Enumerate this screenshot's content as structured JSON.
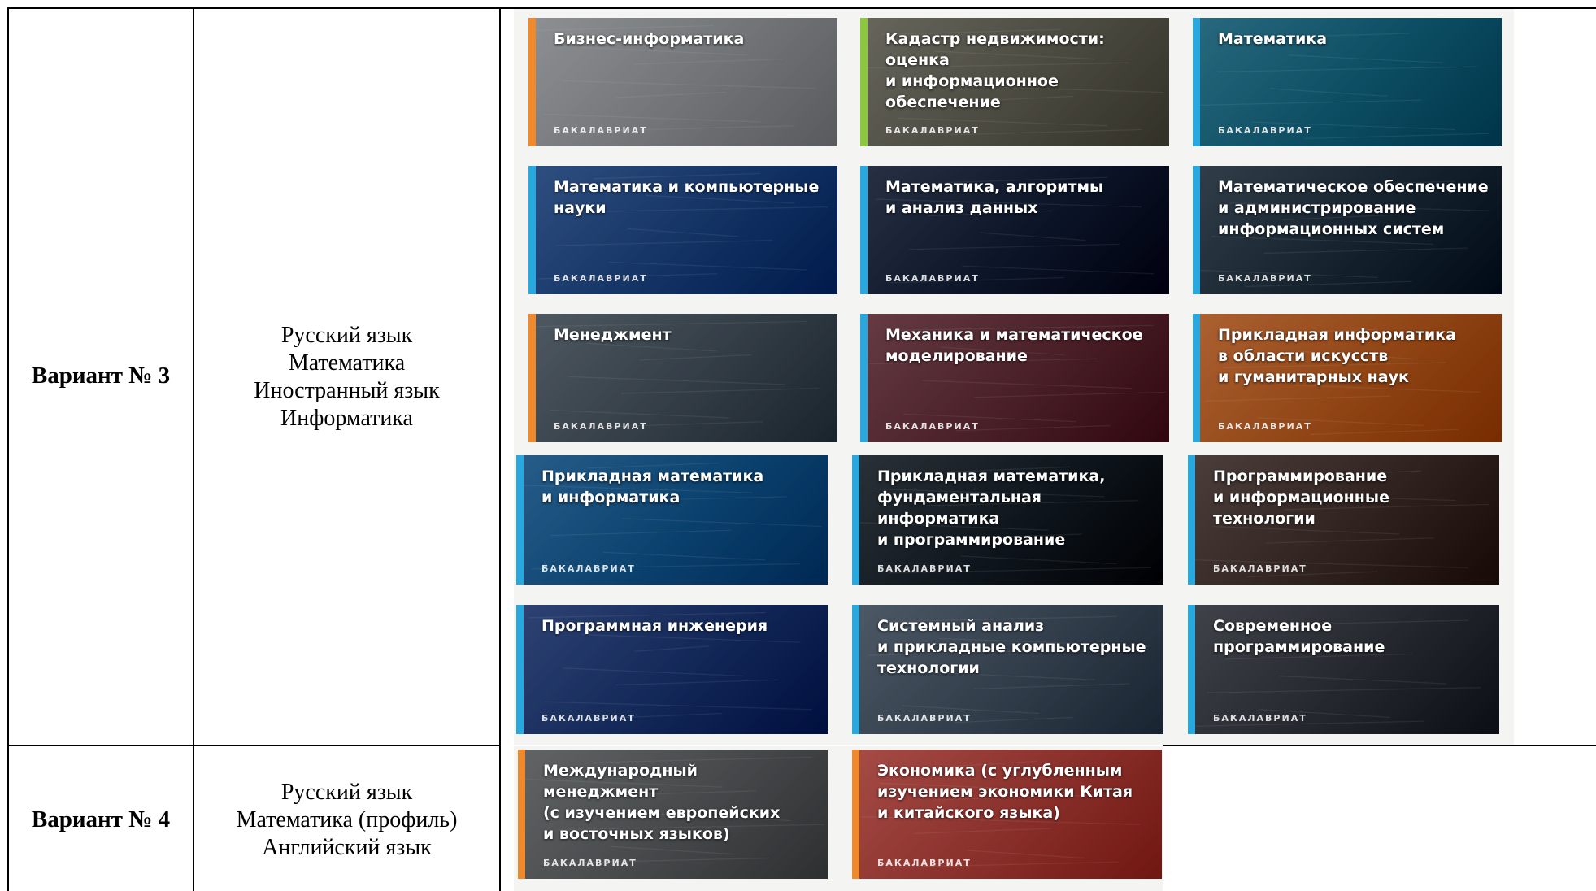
{
  "rows": [
    {
      "variant": "Вариант № 3",
      "subjects": [
        "Русский язык",
        "Математика",
        "Иностранный язык",
        "Информатика"
      ]
    },
    {
      "variant": "Вариант № 4",
      "subjects": [
        "Русский язык",
        "Математика (профиль)",
        "Английский язык"
      ]
    }
  ],
  "cards": [
    {
      "title": "Бизнес-информатика",
      "label": "БАКАЛАВРИАТ",
      "stripe": "#f0892c",
      "bg": "#8a8d90"
    },
    {
      "title": "Кадастр недвижимости: оценка\nи информационное\nобеспечение",
      "label": "БАКАЛАВРИАТ",
      "stripe": "#8dc63f",
      "bg": "#5b5a4e"
    },
    {
      "title": "Математика",
      "label": "БАКАЛАВРИАТ",
      "stripe": "#29a8e0",
      "bg": "#0f5e78"
    },
    {
      "title": "Математика и компьютерные\nнауки",
      "label": "БАКАЛАВРИАТ",
      "stripe": "#29a8e0",
      "bg": "#173e7a"
    },
    {
      "title": "Математика, алгоритмы\nи анализ данных",
      "label": "БАКАЛАВРИАТ",
      "stripe": "#29a8e0",
      "bg": "#0e1a30"
    },
    {
      "title": "Математическое обеспечение\nи администрирование\nинформационных систем",
      "label": "БАКАЛАВРИАТ",
      "stripe": "#29a8e0",
      "bg": "#1a2a38"
    },
    {
      "title": "Менеджмент",
      "label": "БАКАЛАВРИАТ",
      "stripe": "#f0892c",
      "bg": "#3e4a55"
    },
    {
      "title": "Механика и математическое\nмоделирование",
      "label": "БАКАЛАВРИАТ",
      "stripe": "#29a8e0",
      "bg": "#5a2630"
    },
    {
      "title": "Прикладная информатика\nв области искусств\nи гуманитарных наук",
      "label": "БАКАЛАВРИАТ",
      "stripe": "#29a8e0",
      "bg": "#b0541a"
    },
    {
      "title": "Прикладная математика\nи информатика",
      "label": "БАКАЛАВРИАТ",
      "stripe": "#29a8e0",
      "bg": "#0d4f85"
    },
    {
      "title": "Прикладная математика,\nфундаментальная\nинформатика\nи программирование",
      "label": "БАКАЛАВРИАТ",
      "stripe": "#29a8e0",
      "bg": "#111a22"
    },
    {
      "title": "Программирование\nи информационные\nтехнологии",
      "label": "БАКАЛАВРИАТ",
      "stripe": "#29a8e0",
      "bg": "#3a2a26"
    },
    {
      "title": "Программная инженерия",
      "label": "БАКАЛАВРИАТ",
      "stripe": "#29a8e0",
      "bg": "#16306a"
    },
    {
      "title": "Системный анализ\nи прикладные компьютерные\nтехнологии",
      "label": "БАКАЛАВРИАТ",
      "stripe": "#29a8e0",
      "bg": "#3c4a5a"
    },
    {
      "title": "Современное\nпрограммирование",
      "label": "БАКАЛАВРИАТ",
      "stripe": "#29a8e0",
      "bg": "#2c3038"
    },
    {
      "title": "Международный менеджмент\n(с изучением европейских\nи восточных языков)",
      "label": "БАКАЛАВРИАТ",
      "stripe": "#f0892c",
      "bg": "#55585a"
    },
    {
      "title": "Экономика (с углубленным\nизучением экономики Китая\nи китайского языка)",
      "label": "БАКАЛАВРИАТ",
      "stripe": "#f0892c",
      "bg": "#a83a34"
    }
  ]
}
